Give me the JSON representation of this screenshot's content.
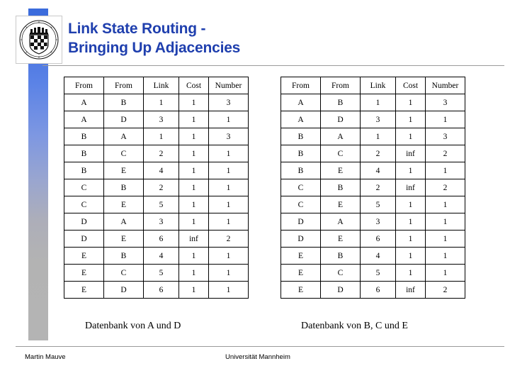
{
  "slide": {
    "title_lines": [
      "Link State Routing -",
      "Bringing Up Adjacencies"
    ],
    "title_color": "#1f3fae",
    "accent_bar_top_color": "#3a6bdc",
    "accent_bar_bottom_color": "#b4b4b4"
  },
  "logo": {
    "name": "university-of-mannheim-seal",
    "ring_text_top": "IN OMNIBUS VERITAS",
    "ring_text_bottom": "UNIVERSITAT MANNHEIM"
  },
  "tables": {
    "columns": [
      "From",
      "From",
      "Link",
      "Cost",
      "Number"
    ],
    "left": {
      "caption": "Datenbank von A und D",
      "rows": [
        [
          "A",
          "B",
          "1",
          "1",
          "3"
        ],
        [
          "A",
          "D",
          "3",
          "1",
          "1"
        ],
        [
          "B",
          "A",
          "1",
          "1",
          "3"
        ],
        [
          "B",
          "C",
          "2",
          "1",
          "1"
        ],
        [
          "B",
          "E",
          "4",
          "1",
          "1"
        ],
        [
          "C",
          "B",
          "2",
          "1",
          "1"
        ],
        [
          "C",
          "E",
          "5",
          "1",
          "1"
        ],
        [
          "D",
          "A",
          "3",
          "1",
          "1"
        ],
        [
          "D",
          "E",
          "6",
          "inf",
          "2"
        ],
        [
          "E",
          "B",
          "4",
          "1",
          "1"
        ],
        [
          "E",
          "C",
          "5",
          "1",
          "1"
        ],
        [
          "E",
          "D",
          "6",
          "1",
          "1"
        ]
      ]
    },
    "right": {
      "caption": "Datenbank von B, C und E",
      "rows": [
        [
          "A",
          "B",
          "1",
          "1",
          "3"
        ],
        [
          "A",
          "D",
          "3",
          "1",
          "1"
        ],
        [
          "B",
          "A",
          "1",
          "1",
          "3"
        ],
        [
          "B",
          "C",
          "2",
          "inf",
          "2"
        ],
        [
          "B",
          "E",
          "4",
          "1",
          "1"
        ],
        [
          "C",
          "B",
          "2",
          "inf",
          "2"
        ],
        [
          "C",
          "E",
          "5",
          "1",
          "1"
        ],
        [
          "D",
          "A",
          "3",
          "1",
          "1"
        ],
        [
          "D",
          "E",
          "6",
          "1",
          "1"
        ],
        [
          "E",
          "B",
          "4",
          "1",
          "1"
        ],
        [
          "E",
          "C",
          "5",
          "1",
          "1"
        ],
        [
          "E",
          "D",
          "6",
          "inf",
          "2"
        ]
      ]
    }
  },
  "footer": {
    "author": "Martin Mauve",
    "organization": "Universität Mannheim"
  }
}
